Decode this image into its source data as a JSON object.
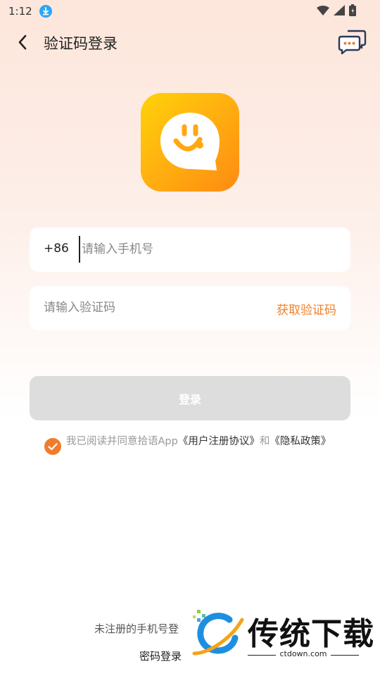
{
  "status_bar": {
    "time": "1:12"
  },
  "nav": {
    "title": "验证码登录"
  },
  "phone": {
    "country_code": "+86",
    "placeholder": "请输入手机号",
    "value": ""
  },
  "code": {
    "placeholder": "请输入验证码",
    "get_code_label": "获取验证码"
  },
  "login": {
    "label": "登录"
  },
  "agreement": {
    "prefix": "我已阅读并同意拾语App",
    "user_agreement": "《用户注册协议》",
    "and": "和",
    "privacy_policy": "《隐私政策》",
    "checked": true
  },
  "footer": {
    "unregistered_note": "未注册的手机号登",
    "password_login": "密码登录"
  },
  "watermark": {
    "name": "传统下载",
    "url": "ctdown.com"
  },
  "colors": {
    "accent": "#f07c2c",
    "logo_yellow": "#ffd20a",
    "logo_orange": "#ff8a12",
    "button_disabled": "#dddddd"
  }
}
